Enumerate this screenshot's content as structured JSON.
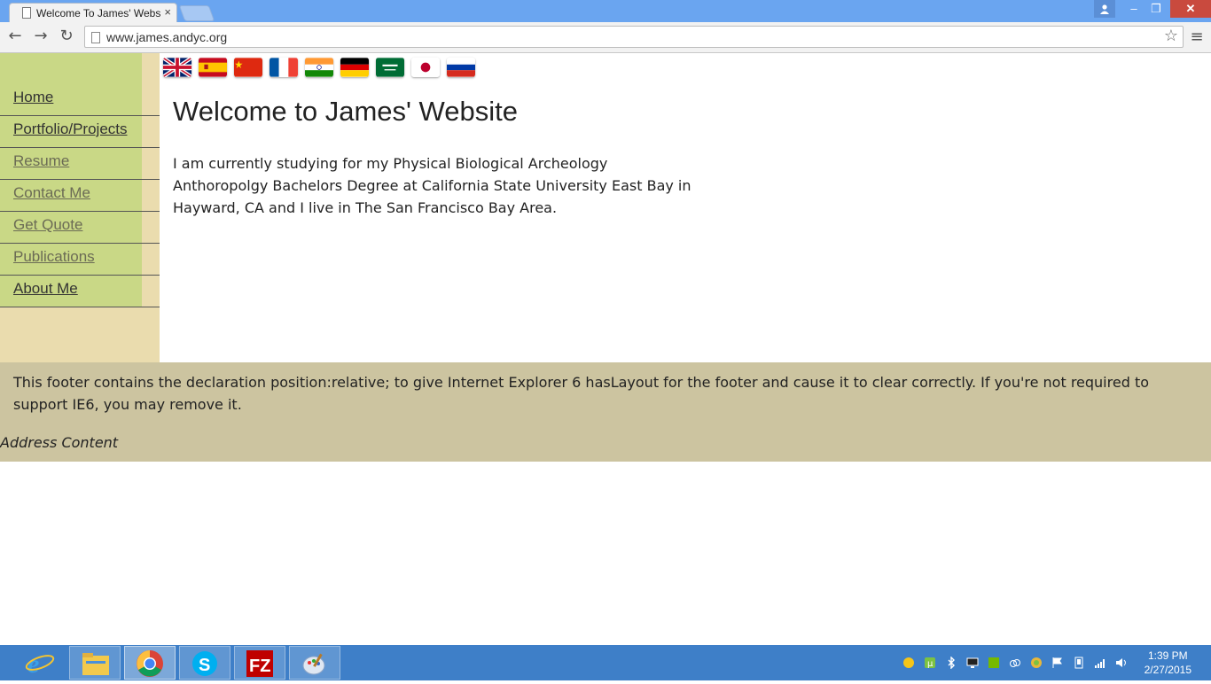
{
  "browser": {
    "tab_title": "Welcome To James' Webs",
    "tab_close": "×",
    "url": "www.james.andyc.org",
    "window_buttons": {
      "minimize": "–",
      "maximize": "❐",
      "close": "✕"
    }
  },
  "site": {
    "nav": [
      {
        "label": "Home",
        "visited": false
      },
      {
        "label": "Portfolio/Projects",
        "visited": false
      },
      {
        "label": "Resume",
        "visited": true
      },
      {
        "label": "Contact Me",
        "visited": true
      },
      {
        "label": "Get Quote",
        "visited": true
      },
      {
        "label": "Publications",
        "visited": true
      },
      {
        "label": "About Me",
        "visited": false
      }
    ],
    "flags": [
      "uk-flag",
      "spain-flag",
      "china-flag",
      "france-flag",
      "india-flag",
      "germany-flag",
      "saudi-arabia-flag",
      "japan-flag",
      "russia-flag"
    ],
    "title": "Welcome to James' Website",
    "intro": "I am currently studying for my Physical Biological Archeology Anthoropolgy Bachelors Degree at California State University East Bay in Hayward, CA and I live in The San Francisco Bay Area.",
    "footer": "This footer contains the declaration position:relative; to give Internet Explorer 6 hasLayout for the footer and cause it to clear correctly. If you're not required to support IE6, you may remove it.",
    "address": "Address Content"
  },
  "taskbar": {
    "apps": [
      "internet-explorer-icon",
      "file-explorer-icon",
      "chrome-icon",
      "skype-icon",
      "filezilla-icon",
      "paint-icon"
    ],
    "time": "1:39 PM",
    "date": "2/27/2015"
  }
}
